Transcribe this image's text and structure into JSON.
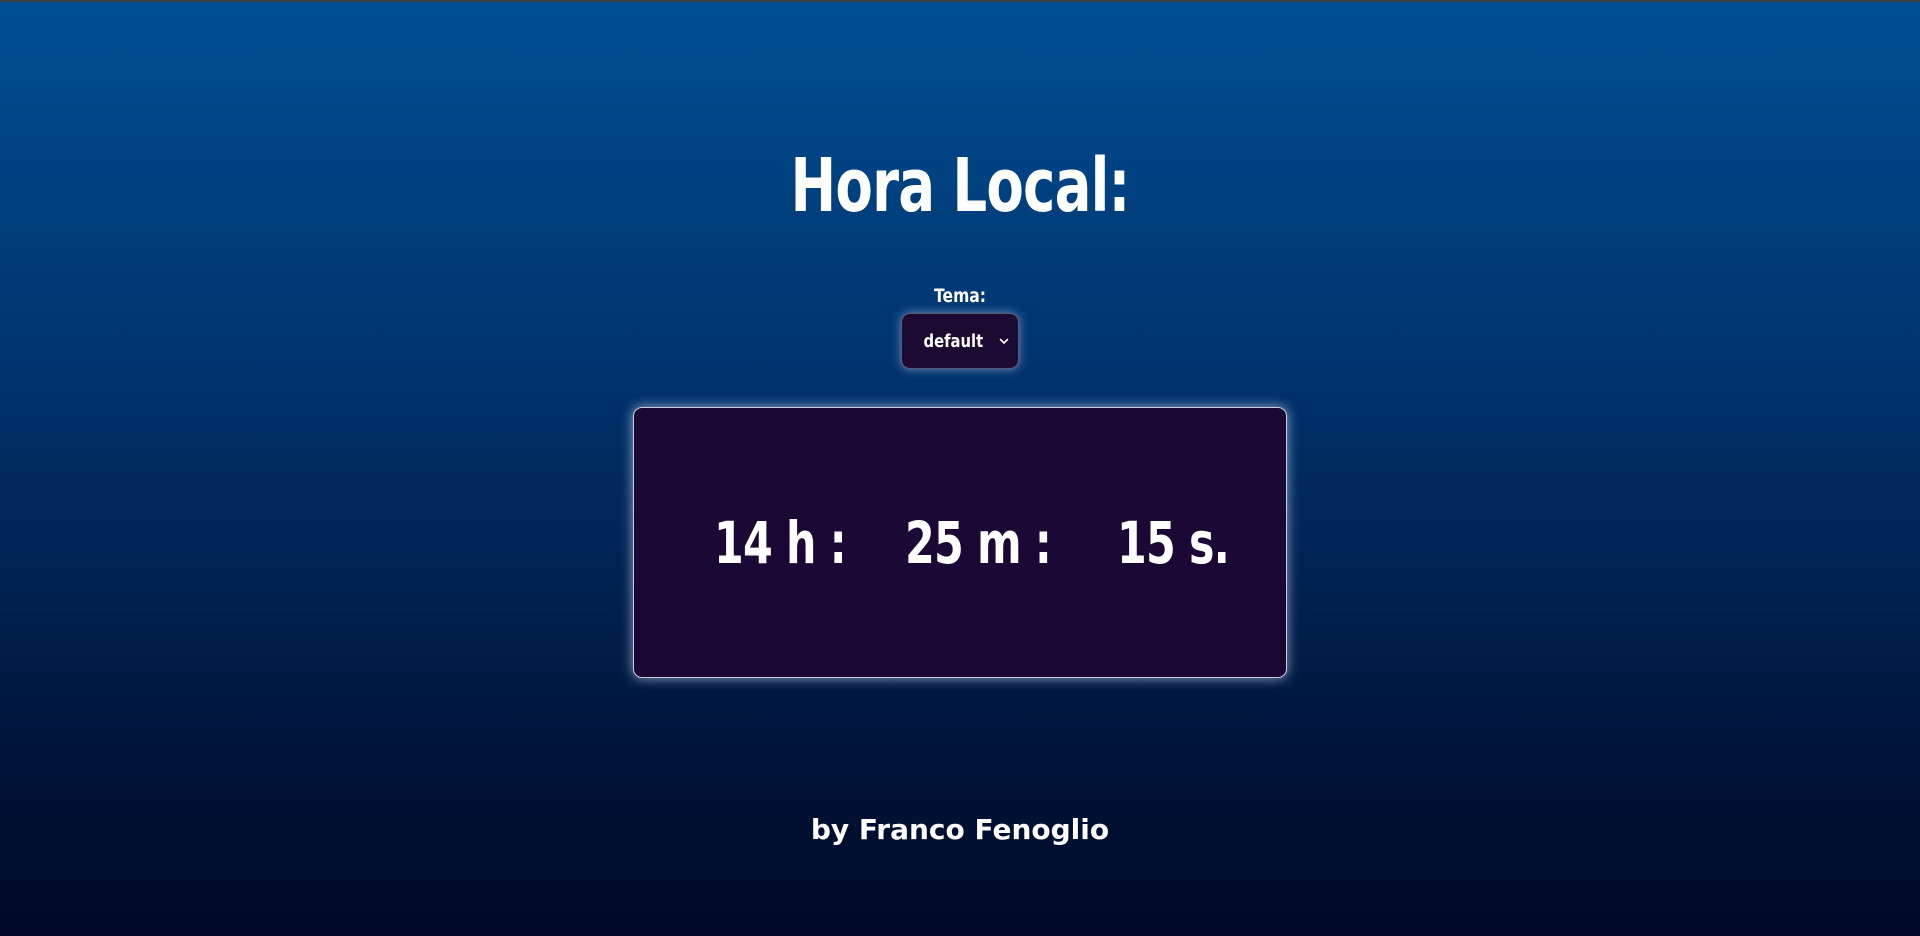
{
  "page": {
    "title": "Hora Local:"
  },
  "theme": {
    "label": "Tema:",
    "selected": "default",
    "chevron_icon": "chevron-down-icon"
  },
  "clock": {
    "hours": "14 h :",
    "minutes": "25 m :",
    "seconds": "15 s."
  },
  "footer": {
    "credit": "by Franco Fenoglio"
  },
  "colors": {
    "background_top": "#004f94",
    "background_bottom": "#000826",
    "panel": "#1c0834",
    "text": "#ffffff"
  }
}
